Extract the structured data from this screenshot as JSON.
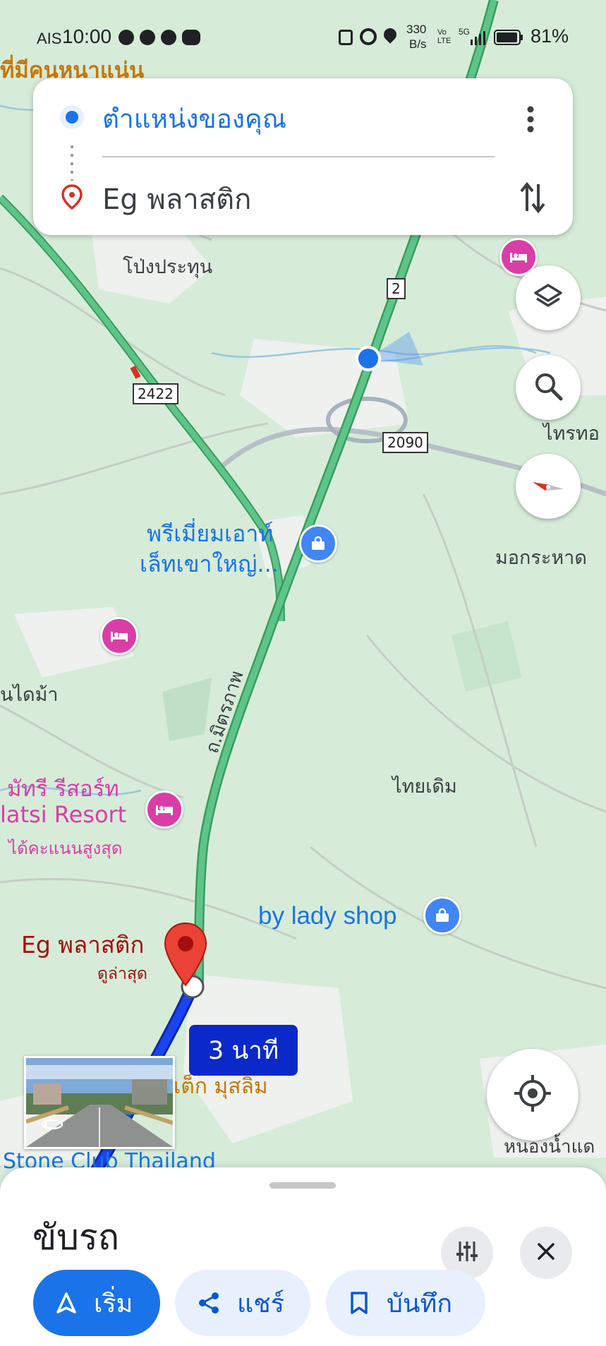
{
  "status_bar": {
    "carrier": "AIS",
    "time": "10:00",
    "net_speed_value": "330",
    "net_speed_unit": "B/s",
    "volte": "Vo LTE",
    "network": "5G",
    "battery": "81%"
  },
  "route_card": {
    "origin": "ตำแหน่งของคุณ",
    "destination": "Eg พลาสติก"
  },
  "map": {
    "top_banner": "ที่มีคนหนาแน่น",
    "places": {
      "pong_prathun": "โป่งประทุน",
      "thai_thue": "ไทรทอ",
      "mok_krahat": "มอกระหาด",
      "premium_outlet_1": "พรีเมี่ยมเอาท์",
      "premium_outlet_2": "เล็ทเขาใหญ่...",
      "nai_dam": "นไดม้า",
      "thai_doem": "ไทยเดิม",
      "resort_th": "มัทรี รีสอร์ท",
      "resort_en": "latsi Resort",
      "resort_rating": "ได้คะแนนสูงสุด",
      "lady_shop": "by lady shop",
      "dest_name": "Eg พลาสติก",
      "dest_sub": "ดูล่าสุด",
      "musalam": "เต็ก มุสลิม",
      "nong_nam": "หนองน้ำแด",
      "stone_club": "Stone Club Thailand",
      "road_name": "ถ.มิตรภาพ"
    },
    "road_shields": {
      "r2": "2",
      "r2422": "2422",
      "r2090": "2090"
    },
    "eta": "3 นาที"
  },
  "bottom_sheet": {
    "mode_title": "ขับรถ",
    "start_label": "เริ่ม",
    "share_label": "แชร์",
    "save_label": "บันทึก"
  },
  "colors": {
    "accent_blue": "#1a73e8",
    "route_blue": "#1a3de8",
    "highway_green": "#46b675",
    "pin_red": "#ea4335",
    "hotel_pink": "#d93ea7",
    "shop_blue": "#4285f4"
  },
  "icons": [
    "messenger-icon",
    "threads-icon",
    "facebook-icon",
    "line-icon",
    "nfc-icon",
    "alarm-icon",
    "location-icon",
    "signal-icon",
    "battery-icon",
    "more-vert-icon",
    "swap-icon",
    "layers-icon",
    "search-icon",
    "compass-icon",
    "my-location-icon",
    "filter-icon",
    "close-icon",
    "navigation-icon",
    "share-icon",
    "bookmark-icon"
  ]
}
